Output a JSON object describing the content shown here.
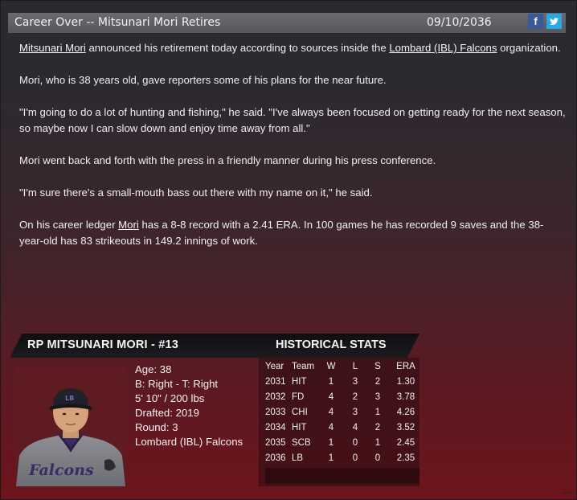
{
  "header": {
    "title": "Career Over -- Mitsunari Mori Retires",
    "date": "09/10/2036",
    "facebook_glyph": "f",
    "twitter_icon": "twitter-bird-icon",
    "facebook_color": "#3b5998",
    "twitter_color": "#29a9e1"
  },
  "article": {
    "p1": {
      "player_link": "Mitsunari Mori",
      "text_a": " announced his retirement today according to sources inside the ",
      "team_link": "Lombard (IBL) Falcons",
      "text_b": " organization."
    },
    "p2": "Mori, who is 38 years old, gave reporters some of his plans for the near future.",
    "p3": "\"I'm going to do a lot of hunting and fishing,\" he said. \"I've always been focused on getting ready for the next season, so maybe now I can slow down and enjoy time away from all.\"",
    "p4": "Mori went back and forth with the press in a friendly manner during his press conference.",
    "p5": "\"I'm sure there's a small-mouth bass out there with my name on it,\" he said.",
    "p6": {
      "text_a": "On his career ledger ",
      "player_link": "Mori",
      "text_b": " has a 8-8 record with a 2.41 ERA. In 100 games he has recorded 9 saves and the 38-year-old has 83 strikeouts in 149.2 innings of work."
    }
  },
  "player_card": {
    "name_line": "RP MITSUNARI MORI - #13",
    "stats_heading": "HISTORICAL STATS",
    "bio": {
      "age": "Age: 38",
      "bats_throws": "B: Right - T: Right",
      "height_weight": "5' 10\" / 200 lbs",
      "drafted": "Drafted: 2019",
      "round": "Round: 3",
      "team": "Lombard (IBL) Falcons"
    },
    "portrait_jersey_text": "Falcons",
    "cap_logo": "LB",
    "stats": {
      "columns": [
        "Year",
        "Team",
        "W",
        "L",
        "S",
        "ERA"
      ],
      "rows": [
        {
          "year": "2031",
          "team": "HIT",
          "w": "1",
          "l": "3",
          "s": "2",
          "era": "1.30"
        },
        {
          "year": "2032",
          "team": "FD",
          "w": "4",
          "l": "2",
          "s": "3",
          "era": "3.78"
        },
        {
          "year": "2033",
          "team": "CHI",
          "w": "4",
          "l": "3",
          "s": "1",
          "era": "4.26"
        },
        {
          "year": "2034",
          "team": "HIT",
          "w": "4",
          "l": "4",
          "s": "2",
          "era": "3.52"
        },
        {
          "year": "2035",
          "team": "SCB",
          "w": "1",
          "l": "0",
          "s": "1",
          "era": "2.45"
        },
        {
          "year": "2036",
          "team": "LB",
          "w": "1",
          "l": "0",
          "s": "0",
          "era": "2.35"
        }
      ]
    }
  }
}
